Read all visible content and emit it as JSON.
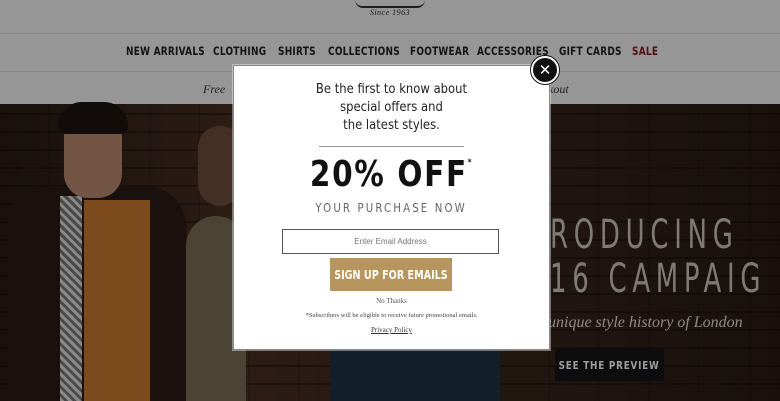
{
  "header": {
    "logo_tagline": "Since 1963",
    "nav": [
      {
        "label": "NEW ARRIVALS"
      },
      {
        "label": "CLOTHING"
      },
      {
        "label": "SHIRTS"
      },
      {
        "label": "COLLECTIONS"
      },
      {
        "label": "FOOTWEAR"
      },
      {
        "label": "ACCESSORIES"
      },
      {
        "label": "GIFT CARDS"
      },
      {
        "label": "SALE"
      }
    ],
    "promo_left": "Free",
    "promo_right": "kout"
  },
  "hero": {
    "title_line1": "RODUCING",
    "title_line2": "16 CAMPAIG",
    "subtitle": "unique style history of London",
    "preview_button": "SEE THE PREVIEW"
  },
  "modal": {
    "heading_line1": "Be the first to know about",
    "heading_line2": "special offers and",
    "heading_line3": "the latest styles.",
    "offer_main": "20% OFF",
    "offer_mark": "*",
    "offer_sub": "YOUR PURCHASE NOW",
    "email_placeholder": "Enter Email Address",
    "signup_button": "SIGN UP FOR EMAILS",
    "no_thanks": "No Thanks",
    "disclaimer": "*Subscribers will be eligible to receive future promotional emails.",
    "privacy_link": "Privacy Policy",
    "close_glyph": "✕"
  },
  "colors": {
    "accent_gold": "#b7965e",
    "sale_red": "#8b1a1a"
  }
}
